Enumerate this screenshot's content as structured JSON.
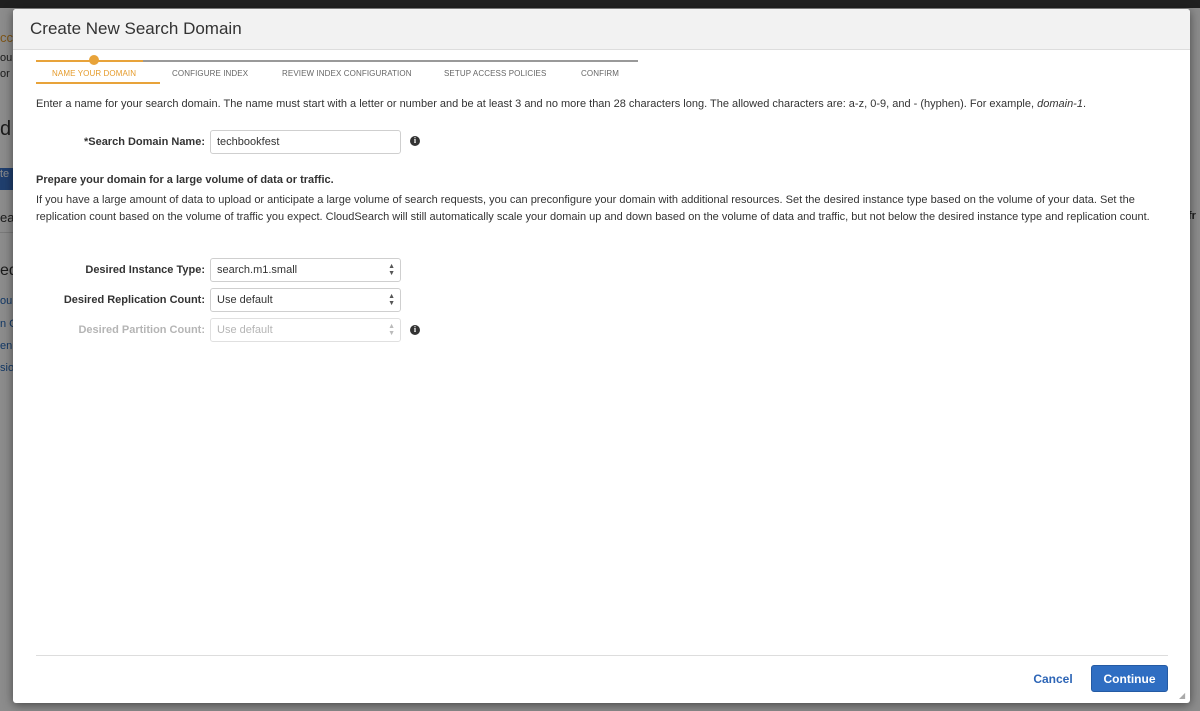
{
  "background": {
    "fragments": {
      "a": "cc",
      "b": "ou",
      "c": "or",
      "d": "d",
      "e": "te",
      "f": "ea",
      "g": "ed",
      "h": "ou",
      "i": "n C",
      "j": "en",
      "k": "sio",
      "l": "fr"
    }
  },
  "modal": {
    "title": "Create New Search Domain",
    "wizard": {
      "steps": [
        {
          "label": "NAME YOUR DOMAIN",
          "active": true
        },
        {
          "label": "CONFIGURE INDEX",
          "active": false
        },
        {
          "label": "REVIEW INDEX CONFIGURATION",
          "active": false
        },
        {
          "label": "SETUP ACCESS POLICIES",
          "active": false
        },
        {
          "label": "CONFIRM",
          "active": false
        }
      ]
    },
    "intro": {
      "text": "Enter a name for your search domain. The name must start with a letter or number and be at least 3 and no more than 28 characters long. The allowed characters are: a-z, 0-9, and - (hyphen). For example, ",
      "example": "domain-1",
      "end": "."
    },
    "domain_name": {
      "label": "*Search Domain Name:",
      "value": "techbookfest",
      "info_icon": "info-icon"
    },
    "scaling": {
      "heading": "Prepare your domain for a large volume of data or traffic.",
      "description": "If you have a large amount of data to upload or anticipate a large volume of search requests, you can preconfigure your domain with additional resources. Set the desired instance type based on the volume of your data. Set the replication count based on the volume of traffic you expect. CloudSearch will still automatically scale your domain up and down based on the volume of data and traffic, but not below the desired instance type and replication count.",
      "instance_type": {
        "label": "Desired Instance Type:",
        "value": "search.m1.small"
      },
      "replication_count": {
        "label": "Desired Replication Count:",
        "value": "Use default"
      },
      "partition_count": {
        "label": "Desired Partition Count:",
        "value": "Use default",
        "disabled": true
      }
    },
    "footer": {
      "cancel_label": "Cancel",
      "continue_label": "Continue"
    },
    "colors": {
      "accent": "#e8a33a",
      "primary_button": "#2f6ec2",
      "link": "#2d65b6"
    }
  }
}
